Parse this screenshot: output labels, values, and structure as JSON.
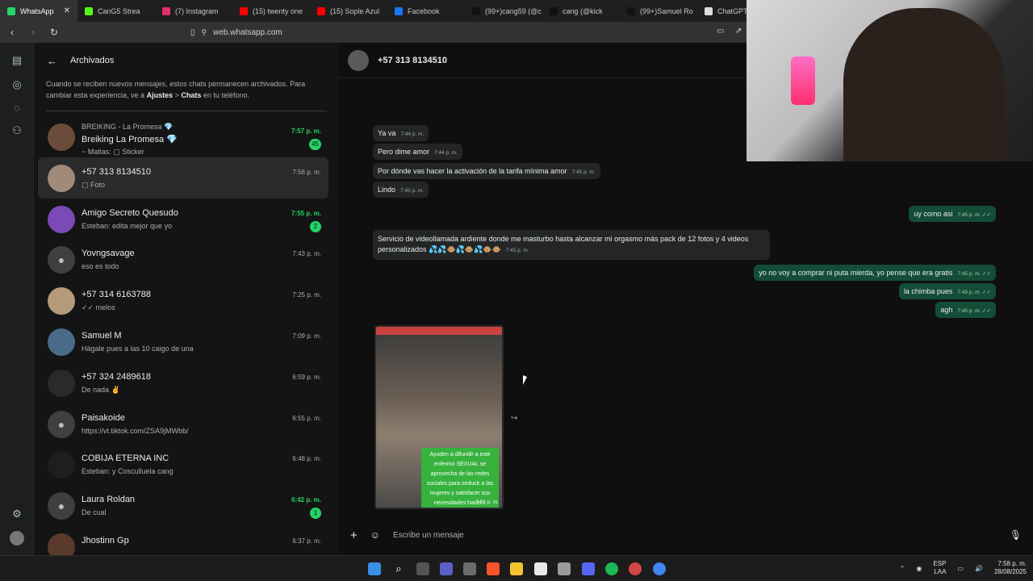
{
  "browser": {
    "tabs": [
      {
        "label": "WhatsApp",
        "color": "#25d366",
        "active": true
      },
      {
        "label": "CanG5 Strea",
        "color": "#53fc18"
      },
      {
        "label": "(7) Instagram",
        "color": "#e1306c"
      },
      {
        "label": "(15) twenty one",
        "color": "#ff0000"
      },
      {
        "label": "(15) Sople Azul",
        "color": "#ff0000"
      },
      {
        "label": "Facebook",
        "color": "#1877f2"
      },
      {
        "label": "(99+)cang59 (@c",
        "color": "#111111"
      },
      {
        "label": "cang (@kick",
        "color": "#111111"
      },
      {
        "label": "(99+)Samuel Ro",
        "color": "#111111"
      },
      {
        "label": "ChatGPT",
        "color": "#dddddd"
      }
    ],
    "url": "web.whatsapp.com"
  },
  "sidebar": {
    "title": "Archivados",
    "note_prefix": "Cuando se reciben nuevos mensajes, estos chats permanecen archivados. Para cambiar esta experiencia, ve a",
    "note_link1": "Ajustes",
    "note_sep": ">",
    "note_link2": "Chats",
    "note_suffix": "en tu teléfono.",
    "chats": [
      {
        "group": "BREIKING - La Promesa 💎",
        "name": "Breiking La Promesa 💎",
        "msg": "~ Matias: ▢ Sticker",
        "time": "7:57 p. m.",
        "badge": "45",
        "unread": true
      },
      {
        "name": "+57 313 8134510",
        "msg": "▢ Foto",
        "time": "7:56 p. m.",
        "selected": true
      },
      {
        "name": "Amigo Secreto Quesudo",
        "msg": "Esteban: edita mejor que yo",
        "time": "7:55 p. m.",
        "badge": "2",
        "unread": true
      },
      {
        "name": "Yovngsavage",
        "msg": "eso es todo",
        "time": "7:43 p. m."
      },
      {
        "name": "+57 314 6163788",
        "msg": "✓✓ melos",
        "time": "7:25 p. m."
      },
      {
        "name": "Samuel M",
        "msg": "Hágale pues a las 10 caigo de una",
        "time": "7:09 p. m."
      },
      {
        "name": "+57 324 2489618",
        "msg": "De nada ✌",
        "time": "6:59 p. m."
      },
      {
        "name": "Paisakoide",
        "msg": "https://vt.tiktok.com/ZSA9jMWbb/",
        "time": "6:55 p. m."
      },
      {
        "name": "COBIJA ETERNA INC",
        "msg": "Esteban: y Cosculluela cang",
        "time": "6:48 p. m."
      },
      {
        "name": "Laura Roldan",
        "msg": "De cual",
        "time": "6:42 p. m.",
        "badge": "1",
        "unread": true
      },
      {
        "name": "Jhostinn Gp",
        "msg": "",
        "time": "6:37 p. m."
      }
    ]
  },
  "conversation": {
    "contact": "+57 313 8134510",
    "messages": [
      {
        "text": "Ya va",
        "time": "7:44 p. m.",
        "dir": "in"
      },
      {
        "text": "Pero dime amor",
        "time": "7:44 p. m.",
        "dir": "in"
      },
      {
        "text": "Por dónde vas hacer la activación de la tarifa mínima amor",
        "time": "7:45 p. m.",
        "dir": "in"
      },
      {
        "text": "Lindo",
        "time": "7:45 p. m.",
        "dir": "in"
      },
      {
        "text": "uy como asi",
        "time": "7:45 p. m. ✓✓",
        "dir": "out"
      },
      {
        "text": "Servicio de videollamada ardiente donde me masturbo hasta alcanzar mi orgasmo más pack de 12 fotos y 4 videos personalizados 💦💦🐵💦🐵💦🐵🐵",
        "time": "7:45 p. m.",
        "dir": "in"
      },
      {
        "text": "yo no voy a comprar ni puta mierda, yo pense que era gratis",
        "time": "7:45 p. m. ✓✓",
        "dir": "out"
      },
      {
        "text": "la chimba pues",
        "time": "7:45 p. m. ✓✓",
        "dir": "out"
      },
      {
        "text": "agh",
        "time": "7:45 p. m. ✓✓",
        "dir": "out"
      }
    ],
    "photo": {
      "caption": "Ayuden a difundir a este enfermo SEXUAL se aprovecha de las redes sociales para seducir a las mujeres y satisfacer sus necesidades hacer...",
      "time": "7:56 p. m."
    },
    "composer_placeholder": "Escribe un mensaje"
  },
  "taskbar": {
    "lang1": "ESP",
    "lang2": "LAA",
    "time": "7:58 p. m.",
    "date": "28/08/2025"
  }
}
